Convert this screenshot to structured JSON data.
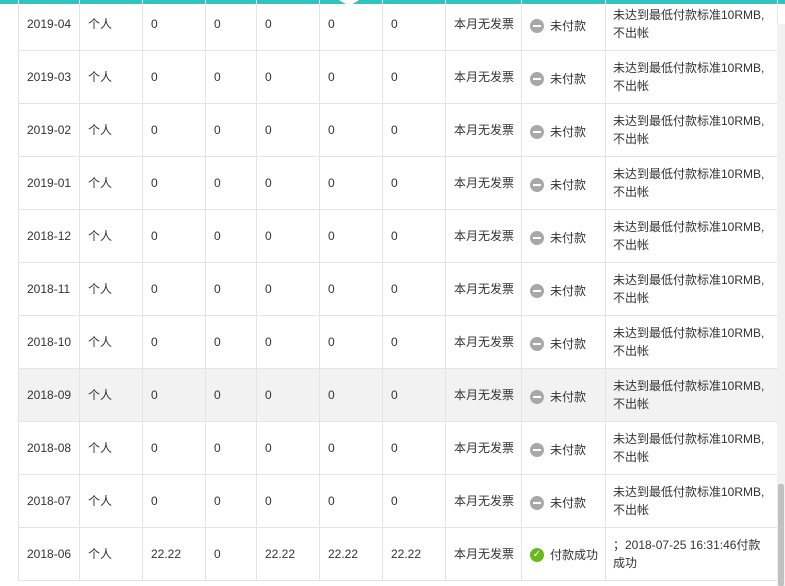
{
  "status_icons": {
    "unpaid": "minus-circle-icon",
    "paid": "check-circle-icon"
  },
  "colors": {
    "accent": "#2ec4c4",
    "paid": "#6ab820",
    "unpaid": "#a8a8a8"
  },
  "rows": [
    {
      "month": "2019-04",
      "type": "个人",
      "c1": "0",
      "c2": "0",
      "c3": "0",
      "c4": "0",
      "c5": "0",
      "invoice": "本月无发票",
      "status": "未付款",
      "status_kind": "unpaid",
      "note": "未达到最低付款标准10RMB,不出帐"
    },
    {
      "month": "2019-03",
      "type": "个人",
      "c1": "0",
      "c2": "0",
      "c3": "0",
      "c4": "0",
      "c5": "0",
      "invoice": "本月无发票",
      "status": "未付款",
      "status_kind": "unpaid",
      "note": "未达到最低付款标准10RMB,不出帐"
    },
    {
      "month": "2019-02",
      "type": "个人",
      "c1": "0",
      "c2": "0",
      "c3": "0",
      "c4": "0",
      "c5": "0",
      "invoice": "本月无发票",
      "status": "未付款",
      "status_kind": "unpaid",
      "note": "未达到最低付款标准10RMB,不出帐"
    },
    {
      "month": "2019-01",
      "type": "个人",
      "c1": "0",
      "c2": "0",
      "c3": "0",
      "c4": "0",
      "c5": "0",
      "invoice": "本月无发票",
      "status": "未付款",
      "status_kind": "unpaid",
      "note": "未达到最低付款标准10RMB,不出帐"
    },
    {
      "month": "2018-12",
      "type": "个人",
      "c1": "0",
      "c2": "0",
      "c3": "0",
      "c4": "0",
      "c5": "0",
      "invoice": "本月无发票",
      "status": "未付款",
      "status_kind": "unpaid",
      "note": "未达到最低付款标准10RMB,不出帐"
    },
    {
      "month": "2018-11",
      "type": "个人",
      "c1": "0",
      "c2": "0",
      "c3": "0",
      "c4": "0",
      "c5": "0",
      "invoice": "本月无发票",
      "status": "未付款",
      "status_kind": "unpaid",
      "note": "未达到最低付款标准10RMB,不出帐"
    },
    {
      "month": "2018-10",
      "type": "个人",
      "c1": "0",
      "c2": "0",
      "c3": "0",
      "c4": "0",
      "c5": "0",
      "invoice": "本月无发票",
      "status": "未付款",
      "status_kind": "unpaid",
      "note": "未达到最低付款标准10RMB,不出帐"
    },
    {
      "month": "2018-09",
      "type": "个人",
      "c1": "0",
      "c2": "0",
      "c3": "0",
      "c4": "0",
      "c5": "0",
      "invoice": "本月无发票",
      "status": "未付款",
      "status_kind": "unpaid",
      "note": "未达到最低付款标准10RMB,不出帐"
    },
    {
      "month": "2018-08",
      "type": "个人",
      "c1": "0",
      "c2": "0",
      "c3": "0",
      "c4": "0",
      "c5": "0",
      "invoice": "本月无发票",
      "status": "未付款",
      "status_kind": "unpaid",
      "note": "未达到最低付款标准10RMB,不出帐"
    },
    {
      "month": "2018-07",
      "type": "个人",
      "c1": "0",
      "c2": "0",
      "c3": "0",
      "c4": "0",
      "c5": "0",
      "invoice": "本月无发票",
      "status": "未付款",
      "status_kind": "unpaid",
      "note": "未达到最低付款标准10RMB,不出帐"
    },
    {
      "month": "2018-06",
      "type": "个人",
      "c1": "22.22",
      "c2": "0",
      "c3": "22.22",
      "c4": "22.22",
      "c5": "22.22",
      "invoice": "本月无发票",
      "status": "付款成功",
      "status_kind": "paid",
      "note": "；2018-07-25 16:31:46付款成功"
    }
  ]
}
